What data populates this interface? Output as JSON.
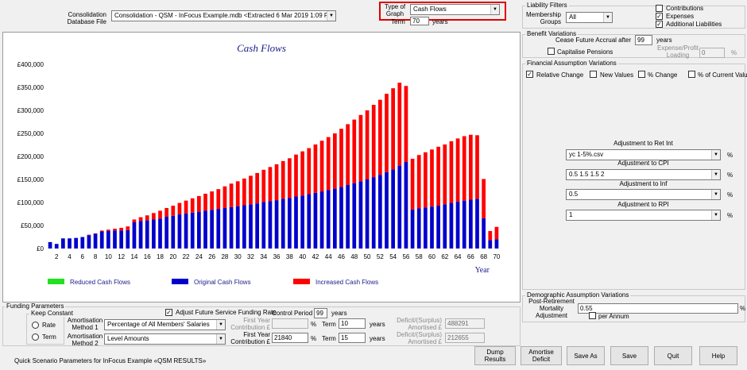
{
  "header": {
    "consolidation_label": "Consolidation\nDatabase File",
    "consolidation_value": "Consolidation - QSM - InFocus Example.mdb <Extracted 6 Mar 2019 1:09 PM>",
    "graph_type_label": "Type of\nGraph",
    "graph_type_value": "Cash Flows",
    "term_label": "Term",
    "term_value": "70",
    "term_unit": "years"
  },
  "chart_data": {
    "type": "bar",
    "title": "Cash Flows",
    "xlabel": "Year",
    "ylabel": "",
    "ylim": [
      0,
      400000
    ],
    "y_ticks": [
      "£0",
      "£50,000",
      "£100,000",
      "£150,000",
      "£200,000",
      "£250,000",
      "£300,000",
      "£350,000",
      "£400,000"
    ],
    "x_ticks": [
      "2",
      "4",
      "6",
      "8",
      "10",
      "12",
      "14",
      "16",
      "18",
      "20",
      "22",
      "24",
      "26",
      "28",
      "30",
      "32",
      "34",
      "36",
      "38",
      "40",
      "42",
      "44",
      "46",
      "48",
      "50",
      "52",
      "54",
      "56",
      "58",
      "60",
      "62",
      "64",
      "66",
      "68",
      "70"
    ],
    "categories": [
      1,
      2,
      3,
      4,
      5,
      6,
      7,
      8,
      9,
      10,
      11,
      12,
      13,
      14,
      15,
      16,
      17,
      18,
      19,
      20,
      21,
      22,
      23,
      24,
      25,
      26,
      27,
      28,
      29,
      30,
      31,
      32,
      33,
      34,
      35,
      36,
      37,
      38,
      39,
      40,
      41,
      42,
      43,
      44,
      45,
      46,
      47,
      48,
      49,
      50,
      51,
      52,
      53,
      54,
      55,
      56,
      57,
      58,
      59,
      60,
      61,
      62,
      63,
      64,
      65,
      66,
      67,
      68,
      69,
      70
    ],
    "series": [
      {
        "name": "Reduced Cash Flows",
        "color": "#22e022",
        "values": [
          0,
          0,
          0,
          0,
          0,
          0,
          0,
          0,
          0,
          0,
          0,
          0,
          0,
          0,
          0,
          0,
          0,
          0,
          0,
          0,
          0,
          0,
          0,
          0,
          0,
          0,
          0,
          0,
          0,
          0,
          0,
          0,
          0,
          0,
          0,
          0,
          0,
          0,
          0,
          0,
          0,
          0,
          0,
          0,
          0,
          0,
          0,
          0,
          0,
          0,
          0,
          0,
          0,
          0,
          0,
          0,
          0,
          0,
          0,
          0,
          0,
          0,
          0,
          0,
          0,
          0,
          0,
          0,
          0,
          0
        ]
      },
      {
        "name": "Original Cash Flows",
        "color": "#0000cc",
        "values": [
          14000,
          10000,
          22000,
          22000,
          23000,
          25000,
          29000,
          32000,
          37000,
          38000,
          39000,
          39000,
          40000,
          57000,
          60000,
          61000,
          63000,
          65000,
          69000,
          71000,
          74000,
          76000,
          78000,
          80000,
          82000,
          84000,
          86000,
          88000,
          90000,
          92000,
          94000,
          96000,
          98000,
          101000,
          103000,
          105000,
          108000,
          110000,
          113000,
          115000,
          118000,
          121000,
          124000,
          127000,
          130000,
          134000,
          138000,
          142000,
          146000,
          150000,
          155000,
          160000,
          166000,
          172000,
          180000,
          188000,
          85000,
          87000,
          89000,
          91000,
          93000,
          96000,
          99000,
          102000,
          104000,
          106000,
          108000,
          66000,
          18000,
          20000
        ]
      },
      {
        "name": "Increased Cash Flows",
        "color": "#ff0000",
        "values": [
          0,
          0,
          0,
          0,
          0,
          0,
          1000,
          1000,
          2000,
          3000,
          4000,
          6000,
          8000,
          6000,
          8000,
          11000,
          14000,
          17000,
          19000,
          22000,
          25000,
          28000,
          31000,
          34000,
          37000,
          40000,
          43000,
          47000,
          51000,
          54000,
          58000,
          62000,
          66000,
          70000,
          74000,
          78000,
          82000,
          86000,
          91000,
          96000,
          100000,
          105000,
          110000,
          115000,
          120000,
          126000,
          132000,
          138000,
          144000,
          150000,
          157000,
          163000,
          170000,
          176000,
          180000,
          165000,
          110000,
          116000,
          120000,
          124000,
          128000,
          130000,
          134000,
          137000,
          140000,
          141000,
          138000,
          85000,
          20000,
          27000
        ]
      }
    ],
    "legend_position": "bottom",
    "x_unit_label": "Year"
  },
  "liability_filters": {
    "title": "Liability Filters",
    "membership_label": "Membership\nGroups",
    "membership_value": "All",
    "checks": [
      {
        "label": "Contributions",
        "checked": false
      },
      {
        "label": "Expenses",
        "checked": true
      },
      {
        "label": "Additional Liabilities",
        "checked": true
      }
    ]
  },
  "benefit_variations": {
    "title": "Benefit Variations",
    "cease_label": "Cease Future Accrual after",
    "cease_value": "99",
    "cease_unit": "years",
    "capitalise_label": "Capitalise Pensions",
    "expense_label": "Expense/Profit\nLoading",
    "expense_value": "0",
    "expense_unit": "%"
  },
  "financial_variations": {
    "title": "Financial Assumption Variations",
    "options": [
      {
        "label": "Relative Change",
        "checked": true
      },
      {
        "label": "New Values",
        "checked": false
      },
      {
        "label": "% Change",
        "checked": false
      },
      {
        "label": "% of Current Value",
        "checked": false
      }
    ],
    "adjustments": [
      {
        "label": "Adjustment to Ret Int",
        "value": "yc 1-5%.csv",
        "unit": "%"
      },
      {
        "label": "Adjustment to CPI",
        "value": "0.5 1.5 1.5 2",
        "unit": "%"
      },
      {
        "label": "Adjustment to Inf",
        "value": "0.5",
        "unit": "%"
      },
      {
        "label": "Adjustment to RPI",
        "value": "1",
        "unit": "%"
      }
    ]
  },
  "demographic_variations": {
    "title": "Demographic Assumption Variations",
    "mortality_label": "Post-Retirement\nMortality\nAdjustment",
    "mortality_value": "0.55",
    "mortality_unit": "%",
    "per_annum_label": "per Annum"
  },
  "funding": {
    "title": "Funding Parameters",
    "keep_constant_title": "Keep Constant",
    "rate_label": "Rate",
    "term_label": "Term",
    "adjust_label": "Adjust Future Service Funding Rate",
    "control_period_label": "Control Period",
    "control_period_value": "99",
    "control_period_unit": "years",
    "method1_label": "Amortisation\nMethod 1",
    "method1_value": "Percentage of All Members' Salaries",
    "method2_label": "Amortisation\nMethod 2",
    "method2_value": "Level Amounts",
    "first_year1_label": "First Year\nContribution £",
    "first_year1_value": "",
    "first_year2_label": "First Year\nContribution £",
    "first_year2_value": "21840",
    "pct1": "%",
    "pct2": "%",
    "term1_label": "Term",
    "term1_value": "10",
    "term2_label": "Term",
    "term2_value": "15",
    "years1": "years",
    "years2": "years",
    "deficit1_label": "Deficit/(Surplus)\nAmortised £",
    "deficit1_value": "488291",
    "deficit2_label": "Deficit/(Surplus)\nAmortised £",
    "deficit2_value": "212655"
  },
  "footer": {
    "status": "Quick Scenario Parameters for InFocus Example «QSM RESULTS»",
    "buttons": [
      "Dump\nResults",
      "Amortise\nDeficit",
      "Save As",
      "Save",
      "Quit",
      "Help"
    ]
  }
}
